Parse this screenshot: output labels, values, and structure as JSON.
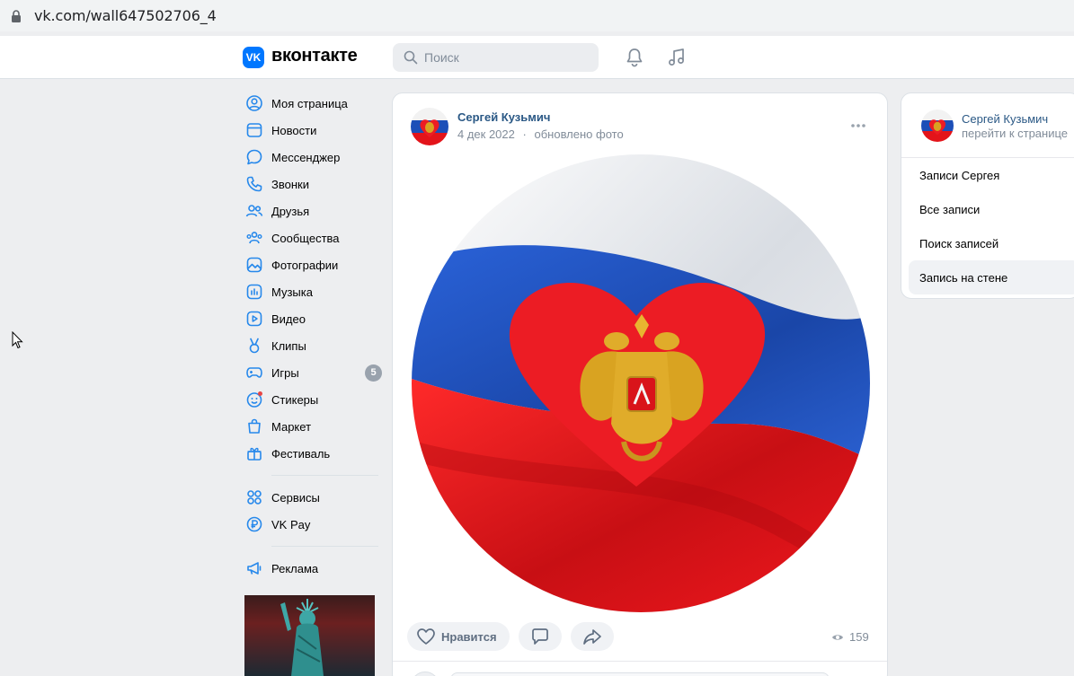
{
  "browser": {
    "url": "vk.com/wall647502706_4"
  },
  "header": {
    "logo_mark": "VK",
    "logo_text": "вконтакте",
    "search_placeholder": "Поиск"
  },
  "nav": {
    "items": [
      {
        "label": "Моя страница",
        "icon": "user-circle-icon"
      },
      {
        "label": "Новости",
        "icon": "newsfeed-icon"
      },
      {
        "label": "Мессенджер",
        "icon": "message-icon"
      },
      {
        "label": "Звонки",
        "icon": "phone-icon"
      },
      {
        "label": "Друзья",
        "icon": "friends-icon"
      },
      {
        "label": "Сообщества",
        "icon": "communities-icon"
      },
      {
        "label": "Фотографии",
        "icon": "photos-icon"
      },
      {
        "label": "Музыка",
        "icon": "music-icon"
      },
      {
        "label": "Видео",
        "icon": "video-icon"
      },
      {
        "label": "Клипы",
        "icon": "clips-icon"
      },
      {
        "label": "Игры",
        "icon": "games-icon",
        "badge": "5"
      },
      {
        "label": "Стикеры",
        "icon": "stickers-icon"
      },
      {
        "label": "Маркет",
        "icon": "market-icon"
      },
      {
        "label": "Фестиваль",
        "icon": "festival-icon"
      }
    ],
    "services": [
      {
        "label": "Сервисы",
        "icon": "services-icon"
      },
      {
        "label": "VK Pay",
        "icon": "vkpay-icon"
      }
    ],
    "ads": {
      "label": "Реклама",
      "icon": "megaphone-icon"
    }
  },
  "post": {
    "author": "Сергей Кузьмич",
    "date": "4 дек 2022",
    "separator": "·",
    "action": "обновлено фото",
    "like_label": "Нравится",
    "views": "159"
  },
  "right_panel": {
    "name": "Сергей Кузьмич",
    "link": "перейти к странице",
    "menu": [
      {
        "label": "Записи Сергея",
        "active": false
      },
      {
        "label": "Все записи",
        "active": false
      },
      {
        "label": "Поиск записей",
        "active": false
      },
      {
        "label": "Запись на стене",
        "active": true
      }
    ]
  },
  "colors": {
    "brand": "#0077ff",
    "link": "#2a5885",
    "muted": "#818c99",
    "flag_white": "#f2f2f2",
    "flag_blue": "#1c4fb8",
    "flag_red": "#e3141a",
    "heart_red": "#ec1c24",
    "eagle_gold": "#d9a321"
  }
}
